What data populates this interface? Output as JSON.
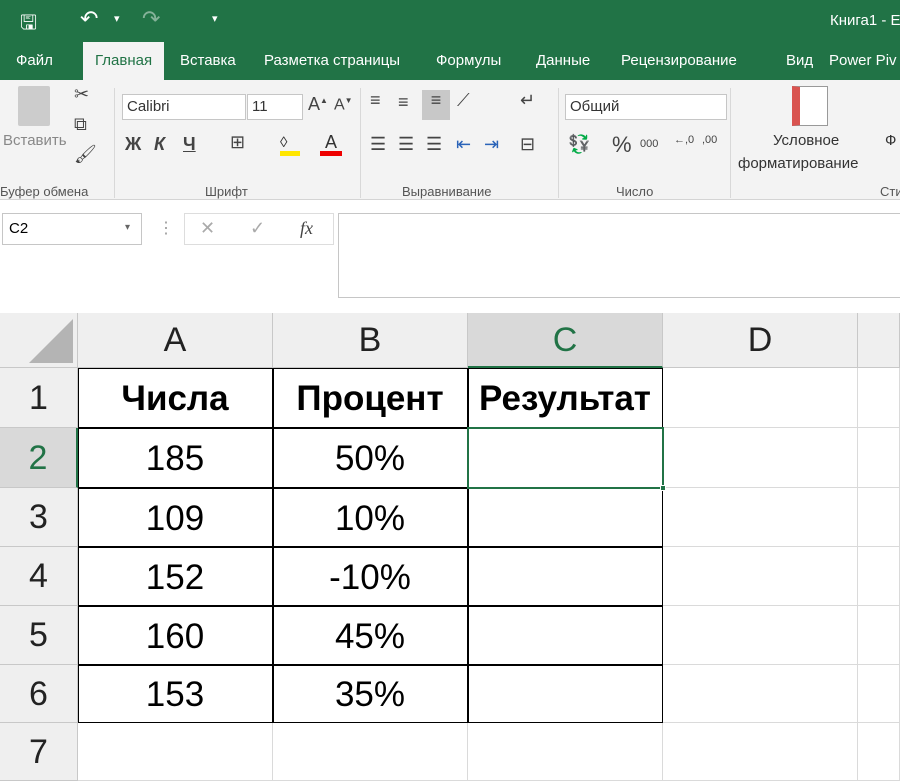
{
  "title": "Книга1 - E",
  "qat": {
    "save": "save-icon",
    "undo": "↶",
    "redo": "↷",
    "more": "▾"
  },
  "tabs": [
    "Файл",
    "Главная",
    "Вставка",
    "Разметка страницы",
    "Формулы",
    "Данные",
    "Рецензирование",
    "Вид",
    "Power Piv"
  ],
  "ribbon": {
    "paste": "Вставить",
    "clipboard": "Буфер обмена",
    "font_name": "Calibri",
    "font_size": "11",
    "bold": "Ж",
    "italic": "К",
    "underline": "Ч",
    "font": "Шрифт",
    "alignment": "Выравнивание",
    "number_format": "Общий",
    "percent": "%",
    "thousands": "000",
    "number": "Число",
    "cond_format_1": "Условное",
    "cond_format_2": "форматирование",
    "styles": "Сти",
    "next_partial": "Ф"
  },
  "formula_bar": {
    "name_box": "C2",
    "fx": "fx",
    "cancel": "✕",
    "enter": "✓",
    "value": ""
  },
  "columns": [
    "A",
    "B",
    "C",
    "D"
  ],
  "rows": [
    "1",
    "2",
    "3",
    "4",
    "5",
    "6",
    "7"
  ],
  "cells": [
    [
      "Числа",
      "Процент",
      "Результат"
    ],
    [
      "185",
      "50%",
      ""
    ],
    [
      "109",
      "10%",
      ""
    ],
    [
      "152",
      "-10%",
      ""
    ],
    [
      "160",
      "45%",
      ""
    ],
    [
      "153",
      "35%",
      ""
    ]
  ],
  "colors": {
    "accent": "#217346"
  }
}
